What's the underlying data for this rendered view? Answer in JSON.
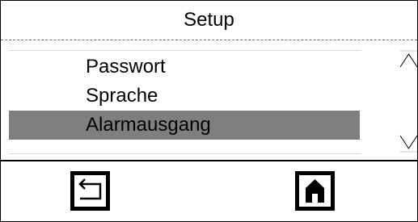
{
  "header": {
    "title": "Setup"
  },
  "menu": {
    "items": [
      {
        "label": "Passwort",
        "selected": false
      },
      {
        "label": "Sprache",
        "selected": false
      },
      {
        "label": "Alarmausgang",
        "selected": true
      }
    ]
  },
  "scroll": {
    "up_icon": "triangle-up-outline",
    "down_icon": "triangle-down-outline"
  },
  "footer": {
    "back_icon": "return-arrow",
    "home_icon": "home"
  },
  "colors": {
    "selected_row": "#7f7f7f",
    "background": "#ffffff",
    "foreground": "#000000"
  }
}
